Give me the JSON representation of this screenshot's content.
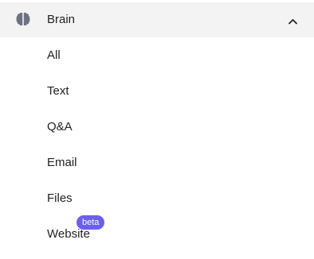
{
  "section": {
    "title": "Brain",
    "icon": "brain-icon",
    "toggle_icon": "chevron-up-icon",
    "expanded": true
  },
  "items": [
    {
      "label": "All"
    },
    {
      "label": "Text"
    },
    {
      "label": "Q&A"
    },
    {
      "label": "Email"
    },
    {
      "label": "Files"
    },
    {
      "label": "Website",
      "badge": "beta"
    }
  ],
  "colors": {
    "header_bg": "#f3f3f4",
    "icon": "#6b7280",
    "badge_bg": "#6b5ff0",
    "text": "#222222"
  }
}
